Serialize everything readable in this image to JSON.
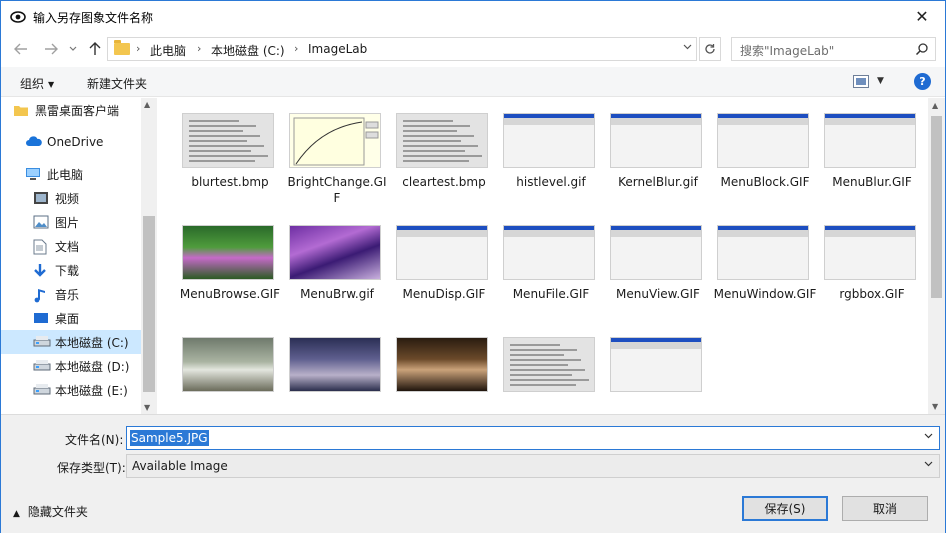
{
  "window": {
    "title": "输入另存图象文件名称",
    "close_glyph": "✕"
  },
  "nav": {
    "breadcrumbs": [
      "此电脑",
      "本地磁盘 (C:)",
      "ImageLab"
    ],
    "search_placeholder": "搜索\"ImageLab\""
  },
  "toolbar": {
    "organize_label": "组织",
    "new_folder_label": "新建文件夹",
    "help_glyph": "?"
  },
  "sidebar": {
    "items": [
      {
        "label": "黑雷桌面客户端",
        "icon": "folder-icon"
      },
      {
        "label": "OneDrive",
        "icon": "cloud-icon"
      },
      {
        "label": "此电脑",
        "icon": "computer-icon"
      },
      {
        "label": "视频",
        "icon": "video-icon"
      },
      {
        "label": "图片",
        "icon": "picture-icon"
      },
      {
        "label": "文档",
        "icon": "document-icon"
      },
      {
        "label": "下载",
        "icon": "download-icon"
      },
      {
        "label": "音乐",
        "icon": "music-icon"
      },
      {
        "label": "桌面",
        "icon": "desktop-icon"
      },
      {
        "label": "本地磁盘 (C:)",
        "icon": "drive-icon"
      },
      {
        "label": "本地磁盘 (D:)",
        "icon": "drive-icon"
      },
      {
        "label": "本地磁盘 (E:)",
        "icon": "drive-icon"
      }
    ],
    "selected": "本地磁盘 (C:)"
  },
  "files": [
    {
      "name": "blurtest.bmp",
      "thumb": "doc"
    },
    {
      "name": "BrightChange.GIF",
      "thumb": "chart"
    },
    {
      "name": "cleartest.bmp",
      "thumb": "doc"
    },
    {
      "name": "histlevel.gif",
      "thumb": "win"
    },
    {
      "name": "KernelBlur.gif",
      "thumb": "win"
    },
    {
      "name": "MenuBlock.GIF",
      "thumb": "win"
    },
    {
      "name": "MenuBlur.GIF",
      "thumb": "win"
    },
    {
      "name": "MenuBrowse.GIF",
      "thumb": "photo2"
    },
    {
      "name": "MenuBrw.gif",
      "thumb": "photo1"
    },
    {
      "name": "MenuDisp.GIF",
      "thumb": "win"
    },
    {
      "name": "MenuFile.GIF",
      "thumb": "win"
    },
    {
      "name": "MenuView.GIF",
      "thumb": "win"
    },
    {
      "name": "MenuWindow.GIF",
      "thumb": "win"
    },
    {
      "name": "rgbbox.GIF",
      "thumb": "win"
    },
    {
      "name": "",
      "thumb": "rocks"
    },
    {
      "name": "",
      "thumb": "girl"
    },
    {
      "name": "",
      "thumb": "paint"
    },
    {
      "name": "",
      "thumb": "doc"
    },
    {
      "name": "",
      "thumb": "win"
    }
  ],
  "form": {
    "filename_label": "文件名(N):",
    "filename_value": "Sample5.JPG",
    "filetype_label": "保存类型(T):",
    "filetype_value": "Available Image",
    "hide_folders_label": "隐藏文件夹",
    "save_label": "保存(S)",
    "cancel_label": "取消"
  },
  "colors": {
    "accent": "#2b79d6",
    "selected_bg": "#cce8ff"
  }
}
